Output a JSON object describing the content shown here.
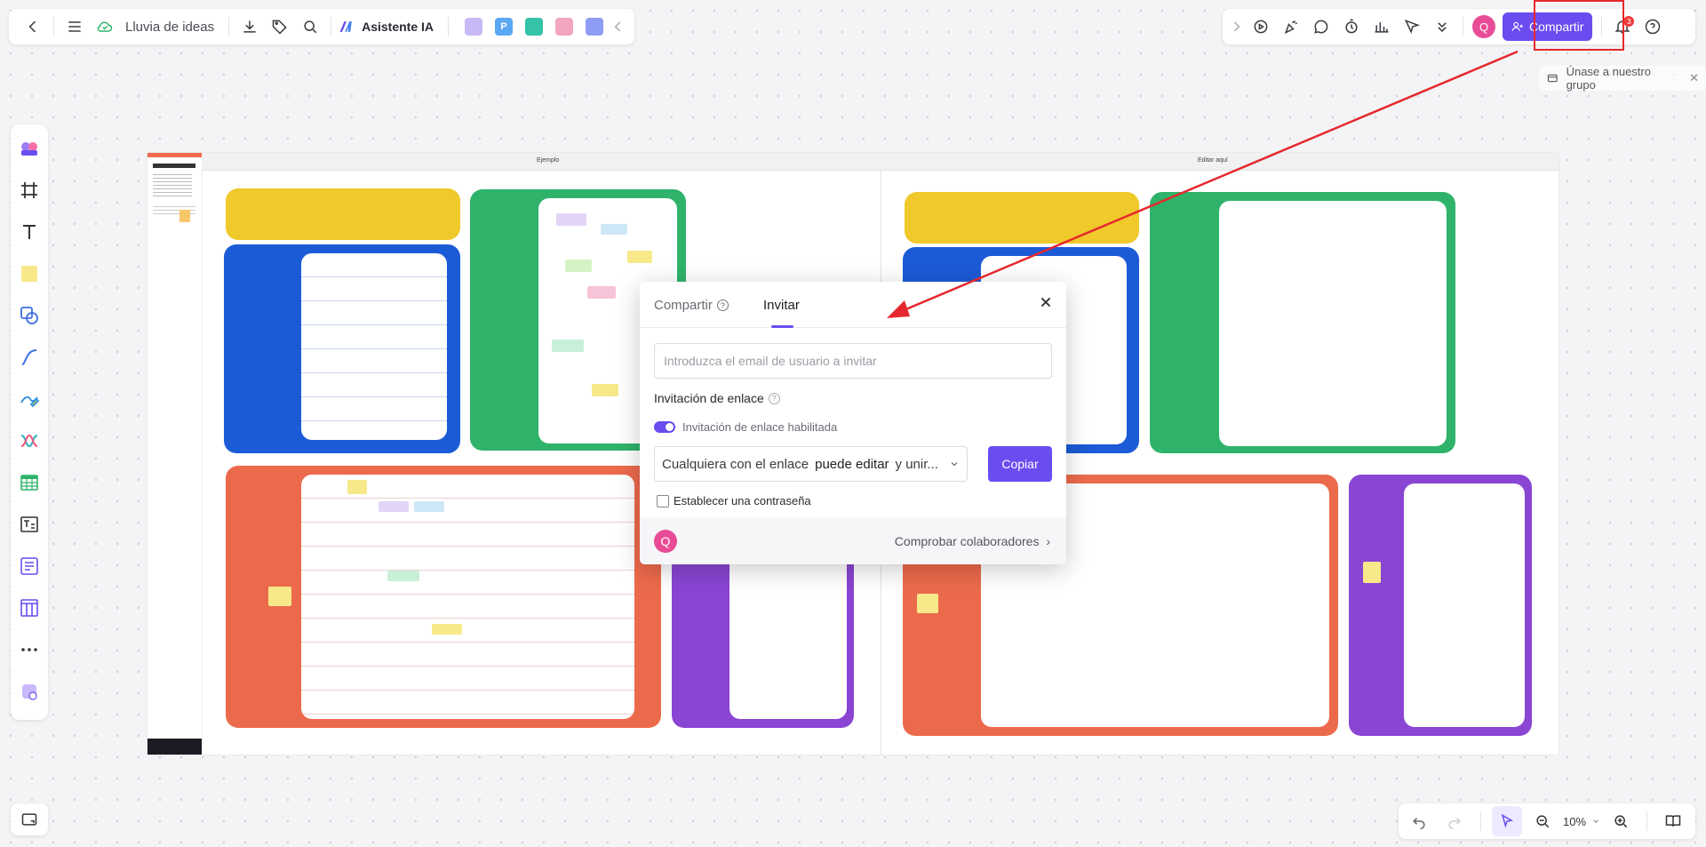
{
  "header": {
    "doc_title": "Lluvia de ideas",
    "ai_label": "Asistente IA",
    "avatar_initial": "Q",
    "share_label": "Compartir",
    "notification_count": "3"
  },
  "join_banner": {
    "text": "Únase a nuestro grupo"
  },
  "canvas": {
    "label_left": "Ejemplo",
    "label_right": "Editar aquí"
  },
  "dialog": {
    "tab_share": "Compartir",
    "tab_invite": "Invitar",
    "help_glyph": "?",
    "email_placeholder": "Introduzca el email de usuario a invitar",
    "email_value": "",
    "link_invite_label": "Invitación de enlace",
    "link_enabled_label": "Invitación de enlace habilitada",
    "perm_prefix": "Cualquiera con el enlace",
    "perm_role": "puede editar",
    "perm_suffix": "y unir...",
    "copy_label": "Copiar",
    "password_label": "Establecer una contraseña",
    "footer_avatar": "Q",
    "check_collab": "Comprobar colaboradores"
  },
  "bottom_bar": {
    "zoom": "10%"
  },
  "colors": {
    "accent": "#6a4cf0",
    "annotation_red": "#e5282d",
    "panel_yellow": "#f0c92a",
    "panel_blue": "#1c5bd6",
    "panel_green": "#2fb36b",
    "panel_orange": "#ec6a4c",
    "panel_purple": "#8a45d3"
  }
}
